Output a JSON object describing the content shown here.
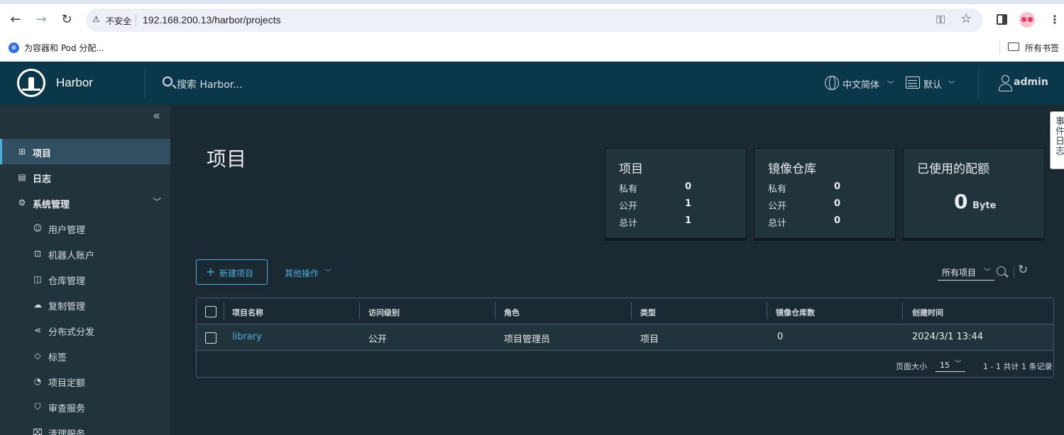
{
  "browser": {
    "security_label": "不安全",
    "url": "192.168.200.13/harbor/projects",
    "bookmark_label": "为容器和 Pod 分配...",
    "all_bookmarks": "所有书签"
  },
  "header": {
    "brand": "Harbor",
    "search_placeholder": "搜索 Harbor...",
    "language": "中文简体",
    "datetime_format": "默认",
    "user": "admin"
  },
  "sidebar": {
    "items": [
      {
        "label": "项目",
        "icon": "projects-icon",
        "active": true
      },
      {
        "label": "日志",
        "icon": "logs-icon"
      },
      {
        "label": "系统管理",
        "icon": "admin-icon"
      },
      {
        "label": "用户管理",
        "icon": "users-icon"
      },
      {
        "label": "机器人账户",
        "icon": "robot-icon"
      },
      {
        "label": "仓库管理",
        "icon": "registry-icon"
      },
      {
        "label": "复制管理",
        "icon": "replication-icon"
      },
      {
        "label": "分布式分发",
        "icon": "distribution-icon"
      },
      {
        "label": "标签",
        "icon": "tag-icon"
      },
      {
        "label": "项目定额",
        "icon": "quota-icon"
      },
      {
        "label": "审查服务",
        "icon": "interrogation-icon"
      },
      {
        "label": "清理服务",
        "icon": "clean-icon"
      }
    ]
  },
  "main": {
    "title": "项目",
    "cards": {
      "projects": {
        "title": "项目",
        "private_label": "私有",
        "private": "0",
        "public_label": "公开",
        "public": "1",
        "total_label": "总计",
        "total": "1"
      },
      "repos": {
        "title": "镜像仓库",
        "private_label": "私有",
        "private": "0",
        "public_label": "公开",
        "public": "0",
        "total_label": "总计",
        "total": "0"
      },
      "quota": {
        "title": "已使用的配额",
        "value": "0",
        "unit": "Byte"
      }
    },
    "new_project": "新建项目",
    "other_actions": "其他操作",
    "filter": "所有项目",
    "table": {
      "columns": [
        "项目名称",
        "访问级别",
        "角色",
        "类型",
        "镜像仓库数",
        "创建时间"
      ],
      "rows": [
        {
          "name": "library",
          "access": "公开",
          "role": "项目管理员",
          "type": "项目",
          "repo_count": "0",
          "created": "2024/3/1 13:44"
        }
      ]
    },
    "pager": {
      "page_size_label": "页面大小",
      "page_size": "15",
      "info": "1 - 1 共计 1 条记录"
    }
  },
  "event_log": "事件日志",
  "colors": {
    "header_bg": "#0a384a",
    "sidebar_bg": "#21333b",
    "main_bg": "#1b2a32",
    "accent": "#49afd9"
  }
}
